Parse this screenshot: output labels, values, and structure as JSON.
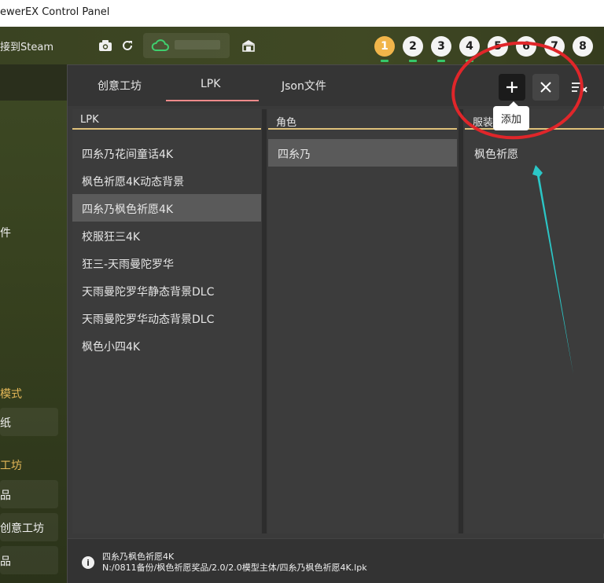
{
  "window": {
    "title": "ewerEX Control Panel"
  },
  "topbar": {
    "steam_label": "接到Steam",
    "screens": [
      "1",
      "2",
      "3",
      "4",
      "5",
      "6",
      "7",
      "8"
    ],
    "active_screen": "1"
  },
  "sidebar": {
    "file_label": "件",
    "section_mode": "模式",
    "item_wallpaper": "纸",
    "section_workshop": "工坊",
    "item_works": "品",
    "item_creative": "创意工坊",
    "item_works2": "品"
  },
  "dialog": {
    "tabs": [
      {
        "label": "创意工坊"
      },
      {
        "label": "LPK"
      },
      {
        "label": "Json文件"
      }
    ],
    "active_tab": "LPK",
    "tooltip_add": "添加",
    "columns": {
      "lpk": {
        "header": "LPK",
        "items": [
          "四糸乃花间童话4K",
          "枫色祈愿4K动态背景",
          "四糸乃枫色祈愿4K",
          "校服狂三4K",
          "狂三-天雨曼陀罗华",
          "天雨曼陀罗华静态背景DLC",
          "天雨曼陀罗华动态背景DLC",
          "枫色小四4K"
        ],
        "selected_index": 2
      },
      "role": {
        "header": "角色",
        "items": [
          "四糸乃"
        ],
        "selected_index": 0
      },
      "outfit": {
        "header": "服装",
        "items": [
          "枫色祈愿"
        ]
      }
    },
    "status": {
      "name": "四糸乃枫色祈愿4K",
      "path": "N:/0811备份/枫色祈愿奖品/2.0/2.0模型主体/四糸乃枫色祈愿4K.lpk"
    }
  },
  "colors": {
    "accent_underline": "#f08a8a",
    "panel_header_line": "#dec07a",
    "annotation_red": "#e0262a",
    "annotation_arrow": "#2bc6c6",
    "active_screen": "#f1b54a"
  }
}
